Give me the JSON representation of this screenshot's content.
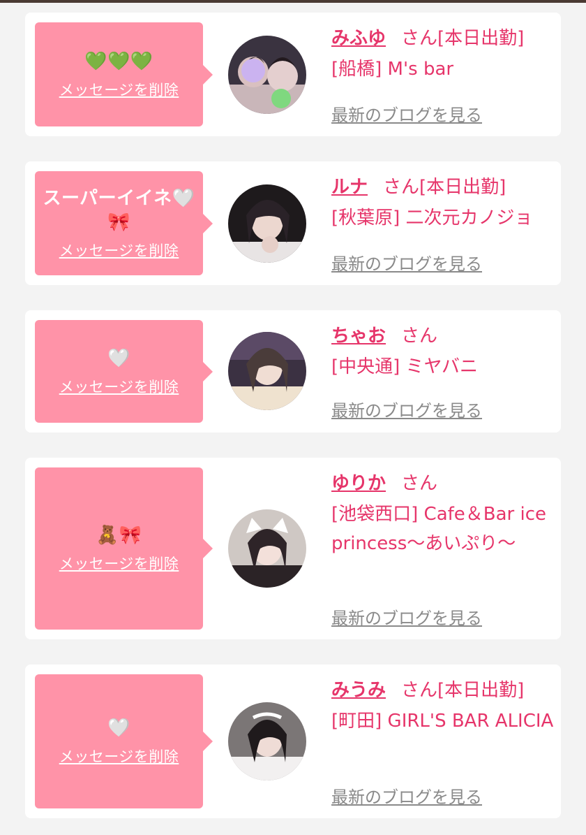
{
  "colors": {
    "card_bg": "#ffffff",
    "page_bg": "#f3f3f3",
    "bubble": "#ff93a8",
    "accent": "#e6356a",
    "link_gray": "#8a8a8a"
  },
  "delete_label": "メッセージを削除",
  "blog_label": "最新のブログを見る",
  "honorific": "さん",
  "items": [
    {
      "message": "💚💚💚",
      "name": "みふゆ",
      "status": "[本日出勤]",
      "shop": "[船橋] M's bar",
      "avatar_icon": "profile-photo"
    },
    {
      "message": "スーパーイイネ🤍🎀",
      "name": "ルナ",
      "status": "[本日出勤]",
      "shop": "[秋葉原] 二次元カノジョ",
      "avatar_icon": "profile-photo"
    },
    {
      "message": "🤍",
      "name": "ちゃお",
      "status": "",
      "shop": "[中央通] ミヤバニ",
      "avatar_icon": "profile-photo"
    },
    {
      "message": "🧸🎀",
      "name": "ゆりか",
      "status": "",
      "shop": "[池袋西口] Cafe＆Bar ice princess～あいぷり～",
      "avatar_icon": "profile-photo"
    },
    {
      "message": "🤍",
      "name": "みうみ",
      "status": "[本日出勤]",
      "shop": "[町田] GIRL'S BAR ALICIA",
      "avatar_icon": "profile-photo"
    }
  ]
}
